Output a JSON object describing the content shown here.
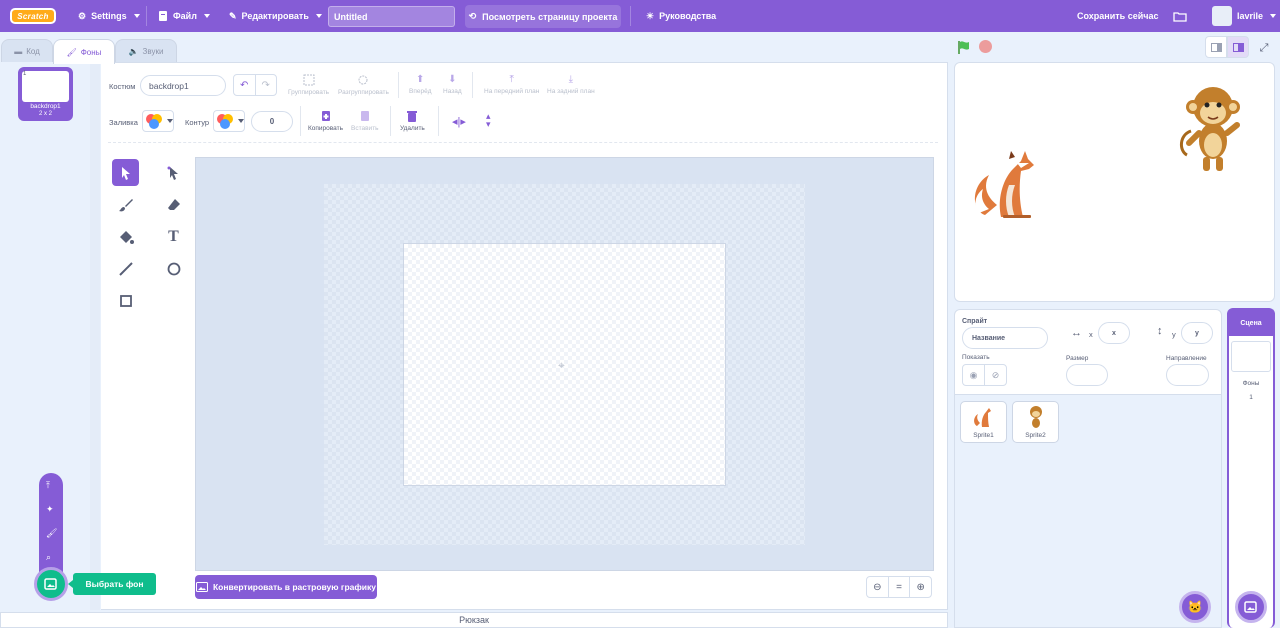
{
  "menubar": {
    "logo": "Scratch",
    "settings": "Settings",
    "file": "Файл",
    "edit": "Редактировать",
    "project_title": "Untitled",
    "see_project_page": "Посмотреть страницу проекта",
    "tutorials": "Руководства",
    "save_now": "Сохранить сейчас",
    "username": "lavrile"
  },
  "tabs": {
    "code": "Код",
    "backdrops": "Фоны",
    "sounds": "Звуки"
  },
  "backdrop_list": [
    {
      "number": "1",
      "name": "backdrop1",
      "size": "2 x 2"
    }
  ],
  "editor": {
    "costume_label": "Костюм",
    "costume_name": "backdrop1",
    "group": "Группировать",
    "ungroup": "Разгруппировать",
    "forward": "Вперёд",
    "backward": "Назад",
    "front": "На передний план",
    "back": "На задний план",
    "fill_label": "Заливка",
    "outline_label": "Контур",
    "outline_width": "0",
    "copy": "Копировать",
    "paste": "Вставить",
    "delete": "Удалить",
    "convert_bitmap": "Конвертировать в растровую графику"
  },
  "add_menu": {
    "tooltip": "Выбрать фон"
  },
  "backpack": "Рюкзак",
  "sprite_info": {
    "sprite_label": "Спрайт",
    "name_placeholder": "Название",
    "x_label": "x",
    "x_value": "x",
    "y_label": "y",
    "y_value": "y",
    "show_label": "Показать",
    "size_label": "Размер",
    "direction_label": "Направление"
  },
  "sprites": [
    {
      "name": "Sprite1"
    },
    {
      "name": "Sprite2"
    }
  ],
  "stage_panel": {
    "title": "Сцена",
    "backdrops_label": "Фоны",
    "backdrops_count": "1"
  },
  "colors": {
    "accent": "#855cd6",
    "green": "#0fbd8c",
    "bg": "#e9f1fc"
  }
}
